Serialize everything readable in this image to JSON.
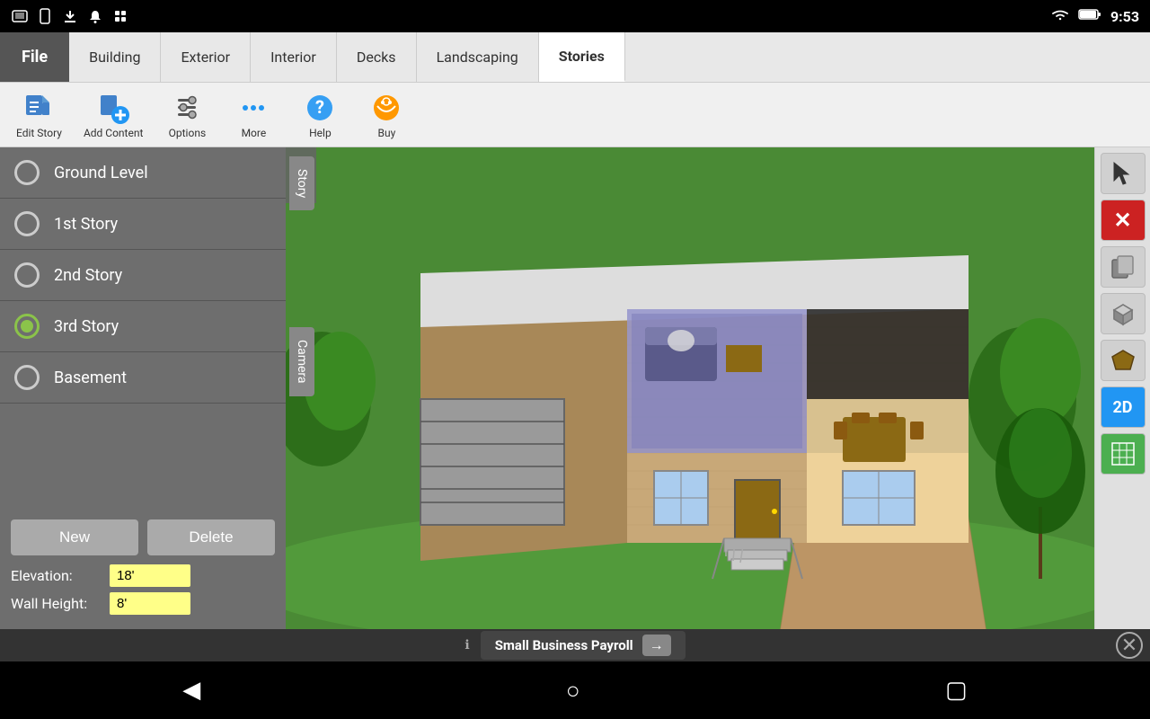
{
  "statusBar": {
    "time": "9:53",
    "icons": [
      "tablet-icon",
      "phone-icon",
      "download-icon",
      "notification-icon",
      "app-icon"
    ],
    "rightIcons": [
      "wifi-icon",
      "battery-icon"
    ]
  },
  "tabs": {
    "file": "File",
    "items": [
      {
        "id": "building",
        "label": "Building"
      },
      {
        "id": "exterior",
        "label": "Exterior"
      },
      {
        "id": "interior",
        "label": "Interior"
      },
      {
        "id": "decks",
        "label": "Decks"
      },
      {
        "id": "landscaping",
        "label": "Landscaping"
      },
      {
        "id": "stories",
        "label": "Stories",
        "active": true
      }
    ]
  },
  "toolbar": {
    "buttons": [
      {
        "id": "edit-story",
        "label": "Edit Story"
      },
      {
        "id": "add-content",
        "label": "Add Content"
      },
      {
        "id": "options",
        "label": "Options"
      },
      {
        "id": "more",
        "label": "More"
      },
      {
        "id": "help",
        "label": "Help"
      },
      {
        "id": "buy",
        "label": "Buy"
      }
    ]
  },
  "stories": {
    "items": [
      {
        "id": "ground",
        "label": "Ground Level",
        "selected": false
      },
      {
        "id": "first",
        "label": "1st Story",
        "selected": false
      },
      {
        "id": "second",
        "label": "2nd Story",
        "selected": false
      },
      {
        "id": "third",
        "label": "3rd Story",
        "selected": true
      },
      {
        "id": "basement",
        "label": "Basement",
        "selected": false
      }
    ],
    "newBtn": "New",
    "deleteBtn": "Delete",
    "elevationLabel": "Elevation:",
    "elevationValue": "18'",
    "wallHeightLabel": "Wall Height:",
    "wallHeightValue": "8'"
  },
  "sideTabs": {
    "story": "Story",
    "camera": "Camera"
  },
  "collapseArrows": {
    "left": "<<",
    "right": ">>"
  },
  "rightToolbar": {
    "cursor": "▶",
    "delete": "✕",
    "copy": "⧉",
    "cube": "◼",
    "shape": "⬟",
    "twoD": "2D",
    "grid": "▦"
  },
  "bottomNav": {
    "back": "◀",
    "home": "○",
    "recent": "▢"
  },
  "adBar": {
    "info": "ℹ",
    "text": "Small Business Payroll",
    "arrow": "→",
    "close": "✕"
  }
}
